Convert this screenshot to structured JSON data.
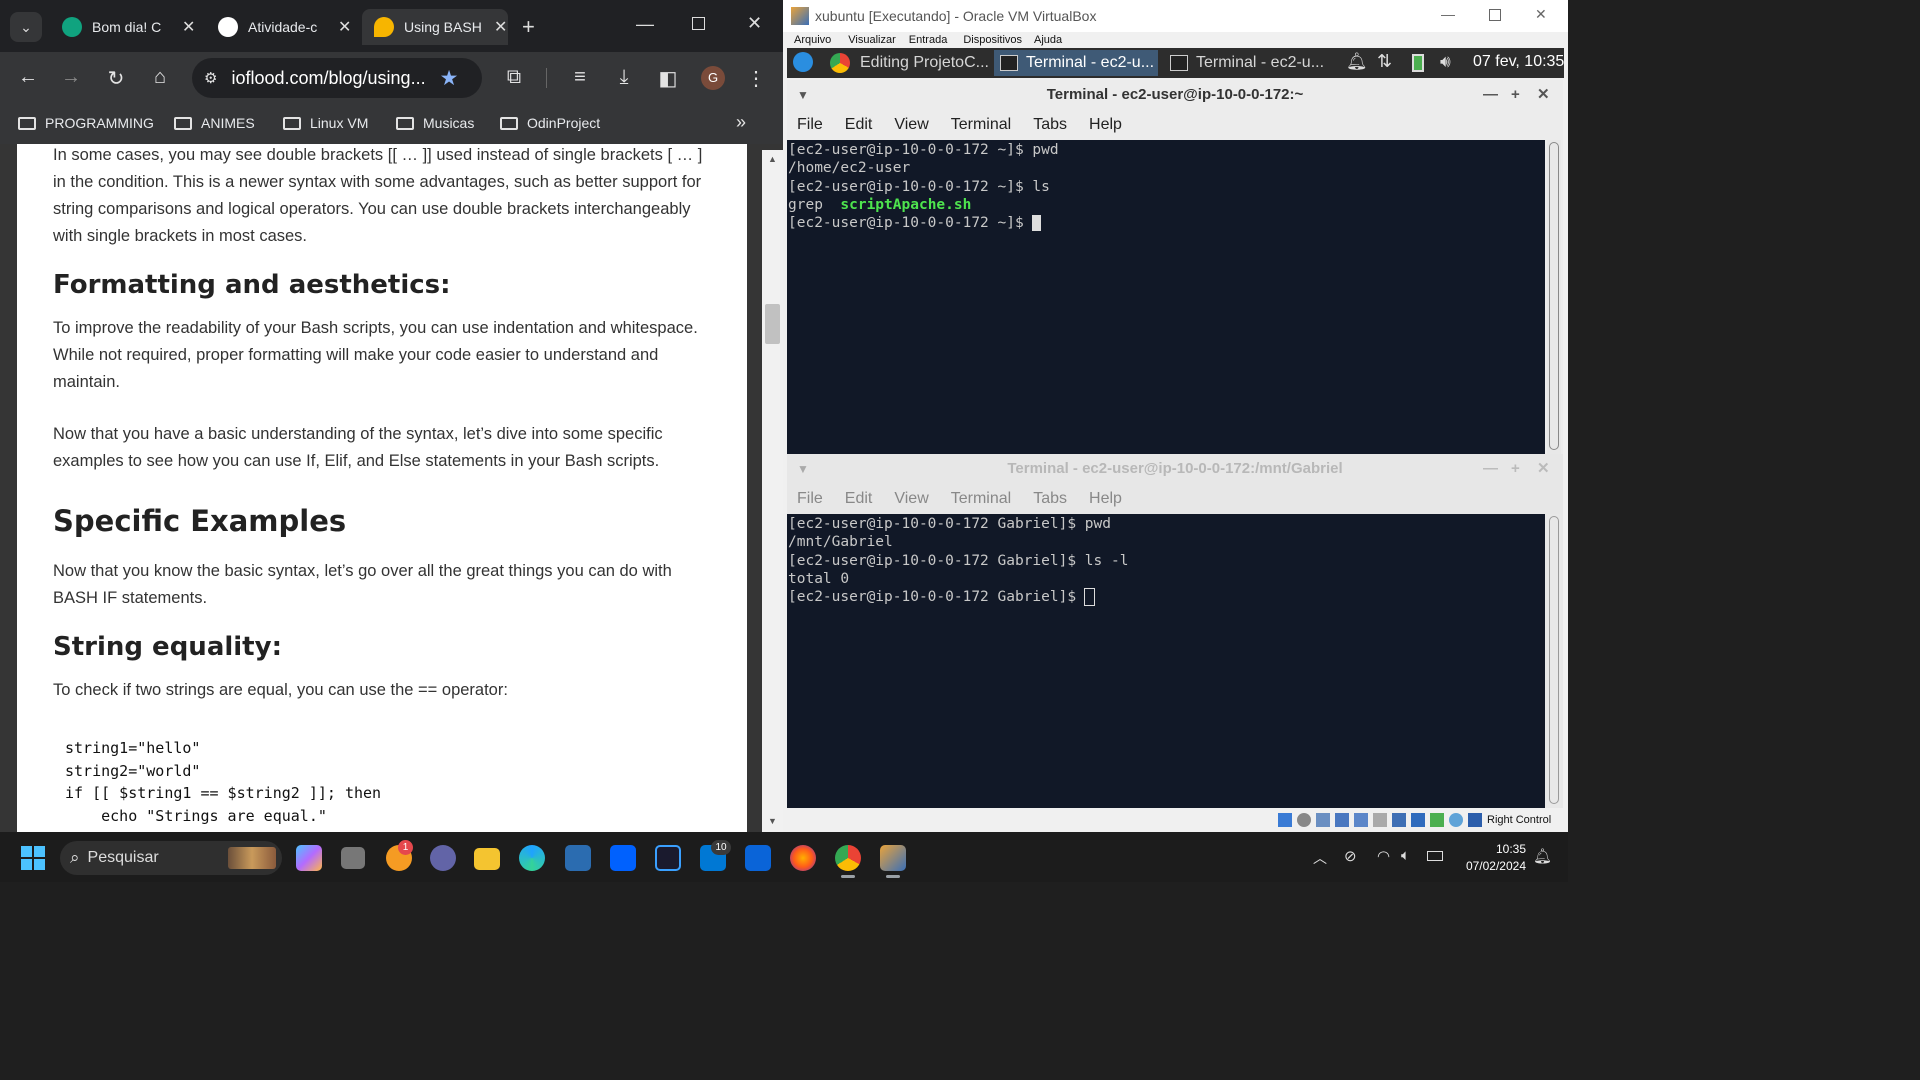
{
  "browser": {
    "tabs": [
      {
        "title": "Bom dia! C",
        "active": false
      },
      {
        "title": "Atividade-c",
        "active": false
      },
      {
        "title": "Using BASH",
        "active": true
      }
    ],
    "url": "ioflood.com/blog/using...",
    "profile_initial": "G",
    "bookmarks": [
      "PROGRAMMING",
      "ANIMES",
      "Linux VM",
      "Musicas",
      "OdinProject"
    ]
  },
  "article": {
    "p1": "In some cases, you may see double brackets [[ … ]] used instead of single brackets [ … ] in the condition. This is a newer syntax with some advantages, such as better support for string comparisons and logical operators. You can use double brackets interchangeably with single brackets in most cases.",
    "h_formatting": "Formatting and aesthetics:",
    "p2": "To improve the readability of your Bash scripts, you can use indentation and whitespace. While not required, proper formatting will make your code easier to understand and maintain.",
    "p3": "Now that you have a basic understanding of the syntax, let’s dive into some specific examples to see how you can use If, Elif, and Else statements in your Bash scripts.",
    "h_specific": "Specific Examples",
    "p4": "Now that you know the basic syntax, let’s go over all the great things you can do with BASH IF statements.",
    "h_string": "String equality:",
    "p5": "To check if two strings are equal, you can use the == operator:",
    "code": "string1=\"hello\"\nstring2=\"world\"\nif [[ $string1 == $string2 ]]; then\n    echo \"Strings are equal.\""
  },
  "vbox": {
    "title": "xubuntu [Executando] - Oracle VM VirtualBox",
    "menu": [
      "Arquivo",
      "Visualizar",
      "Entrada",
      "Dispositivos",
      "Ajuda"
    ],
    "host_key": "Right Control"
  },
  "xfce_panel": {
    "tasks": [
      "Editing ProjetoC...",
      "Terminal - ec2-u...",
      "Terminal - ec2-u..."
    ],
    "clock": "07 fev, 10:35"
  },
  "terminal1": {
    "title": "Terminal - ec2-user@ip-10-0-0-172:~",
    "lines": [
      "[ec2-user@ip-10-0-0-172 ~]$ pwd",
      "/home/ec2-user",
      "[ec2-user@ip-10-0-0-172 ~]$ ls"
    ],
    "ls_plain": "grep",
    "ls_script": "scriptApache.sh",
    "prompt": "[ec2-user@ip-10-0-0-172 ~]$ "
  },
  "terminal2": {
    "title": "Terminal - ec2-user@ip-10-0-0-172:/mnt/Gabriel",
    "lines": [
      "[ec2-user@ip-10-0-0-172 Gabriel]$ pwd",
      "/mnt/Gabriel",
      "[ec2-user@ip-10-0-0-172 Gabriel]$ ls -l",
      "total 0"
    ],
    "prompt": "[ec2-user@ip-10-0-0-172 Gabriel]$ "
  },
  "term_menu": [
    "File",
    "Edit",
    "View",
    "Terminal",
    "Tabs",
    "Help"
  ],
  "taskbar": {
    "search": "Pesquisar",
    "notif_badge": "1",
    "mail_badge": "10",
    "time": "10:35",
    "date": "07/02/2024"
  }
}
